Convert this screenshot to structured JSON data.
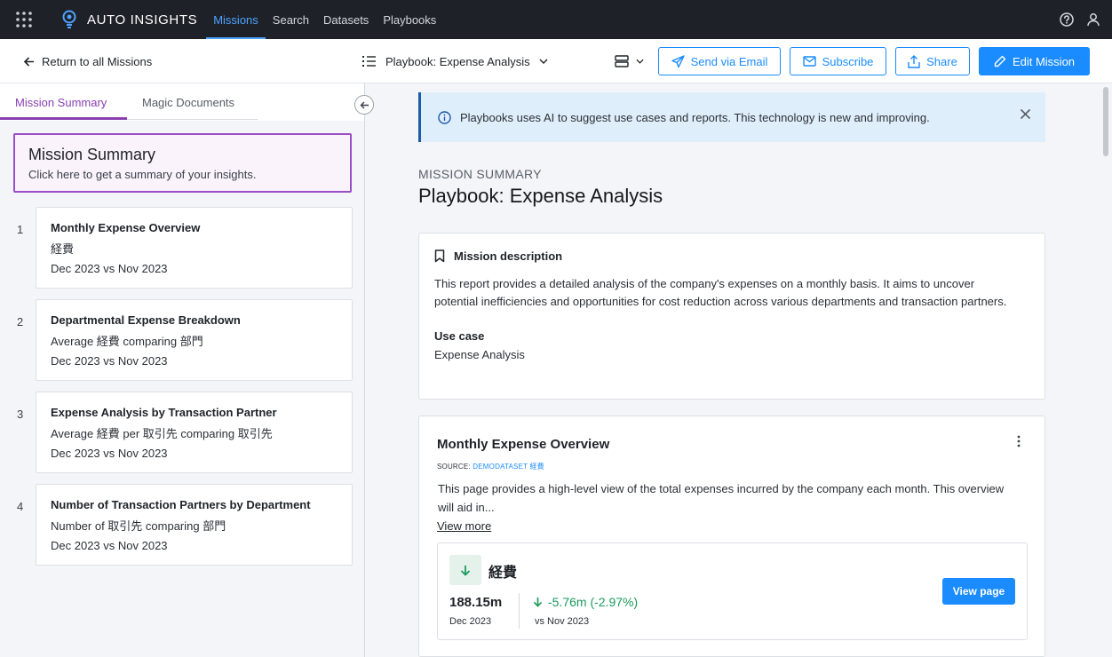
{
  "app": {
    "brand": "AUTO INSIGHTS",
    "nav": [
      "Missions",
      "Search",
      "Datasets",
      "Playbooks"
    ],
    "active_nav": "Missions"
  },
  "toolbar": {
    "back_label": "Return to all Missions",
    "playbook_select": "Playbook: Expense Analysis",
    "buttons": {
      "send_email": "Send via Email",
      "subscribe": "Subscribe",
      "share": "Share",
      "edit_mission": "Edit Mission"
    }
  },
  "left_panel": {
    "tabs": [
      "Mission Summary",
      "Magic Documents"
    ],
    "active_tab": "Mission Summary",
    "summary_card": {
      "title": "Mission Summary",
      "subtitle": "Click here to get a summary of your insights."
    },
    "insights": [
      {
        "num": "1",
        "title": "Monthly Expense Overview",
        "subtitle": "経費",
        "date": "Dec 2023 vs Nov 2023"
      },
      {
        "num": "2",
        "title": "Departmental Expense Breakdown",
        "subtitle": "Average 経費 comparing 部門",
        "date": "Dec 2023 vs Nov 2023"
      },
      {
        "num": "3",
        "title": "Expense Analysis by Transaction Partner",
        "subtitle": "Average 経費 per 取引先 comparing 取引先",
        "date": "Dec 2023 vs Nov 2023"
      },
      {
        "num": "4",
        "title": "Number of Transaction Partners by Department",
        "subtitle": "Number of 取引先 comparing 部門",
        "date": "Dec 2023 vs Nov 2023"
      }
    ]
  },
  "main": {
    "banner": "Playbooks uses AI to suggest use cases and reports. This technology is new and improving.",
    "eyebrow": "MISSION SUMMARY",
    "title": "Playbook: Expense Analysis",
    "description_card": {
      "heading": "Mission description",
      "body": "This report provides a detailed analysis of the company's expenses on a monthly basis. It aims to uncover potential inefficiencies and opportunities for cost reduction across various departments and transaction partners.",
      "use_case_label": "Use case",
      "use_case_value": "Expense Analysis"
    },
    "overview_card": {
      "title": "Monthly Expense Overview",
      "source_label": "SOURCE:",
      "source_value": "DEMODATASET 経費",
      "body": "This page provides a high-level view of the total expenses incurred by the company each month. This overview will aid in...",
      "view_more": "View more",
      "metric": {
        "name": "経費",
        "value": "188.15m",
        "period": "Dec 2023",
        "change": "-5.76m (-2.97%)",
        "vs": "vs Nov 2023",
        "button": "View page"
      }
    }
  },
  "colors": {
    "topnav_bg": "#1e2128",
    "accent_blue": "#1a8cff",
    "accent_purple": "#8a3fb0",
    "positive_green": "#1d9a5c",
    "banner_bg": "#dfeefb"
  },
  "icons": [
    "app-grid-icon",
    "lightbulb-logo-icon",
    "help-icon",
    "user-icon",
    "arrow-left-icon",
    "list-icon",
    "chevron-down-icon",
    "layout-icon",
    "send-icon",
    "mail-icon",
    "share-icon",
    "pencil-icon",
    "info-icon",
    "close-icon",
    "bookmark-icon",
    "more-vertical-icon",
    "arrow-down-icon"
  ]
}
